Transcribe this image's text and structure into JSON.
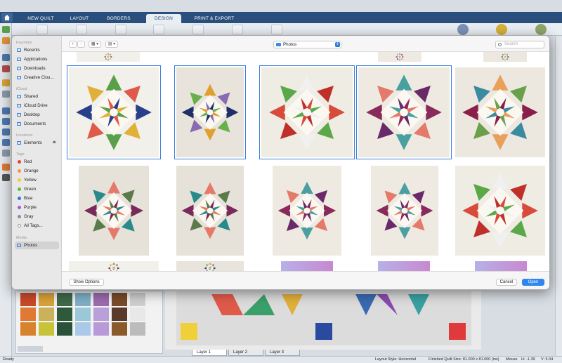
{
  "app": {
    "tabs": [
      "NEW QUILT",
      "LAYOUT",
      "BORDERS",
      "DESIGN",
      "PRINT & EXPORT"
    ],
    "active_tab": "DESIGN",
    "layer_tabs": [
      "Layer 1",
      "Layer 2",
      "Layer 3"
    ],
    "status": {
      "left": "Ready",
      "layout_style": "Layout Style: Horizontal",
      "quilt_size": "Finished Quilt Size: 81.000 x 81.000 (ins)",
      "mouse": "Mouse",
      "h": "H: -1.39",
      "v": "V: 5.04"
    }
  },
  "dialog": {
    "sidebar": {
      "favorites_header": "Favorites",
      "favorites": [
        "Recents",
        "Applications",
        "Downloads",
        "Creative Clou..."
      ],
      "icloud_header": "iCloud",
      "icloud": [
        "Shared",
        "iCloud Drive",
        "Desktop",
        "Documents"
      ],
      "locations_header": "Locations",
      "locations": [
        "Elements"
      ],
      "tags_header": "Tags",
      "tags": [
        {
          "label": "Red",
          "color": "#e5443b"
        },
        {
          "label": "Orange",
          "color": "#f29a32"
        },
        {
          "label": "Yellow",
          "color": "#f5cf2d"
        },
        {
          "label": "Green",
          "color": "#5cc04a"
        },
        {
          "label": "Blue",
          "color": "#2f7bd6"
        },
        {
          "label": "Purple",
          "color": "#a65ccf"
        },
        {
          "label": "Gray",
          "color": "#8e8e93"
        }
      ],
      "all_tags": "All Tags...",
      "media_header": "Media",
      "media": [
        "Photos"
      ]
    },
    "location": "Photos",
    "search_placeholder": "Search",
    "show_options": "Show Options",
    "cancel": "Cancel",
    "open": "Open"
  },
  "colors": {
    "accent": "#2f86ee",
    "app_header": "#2a4f7c"
  }
}
